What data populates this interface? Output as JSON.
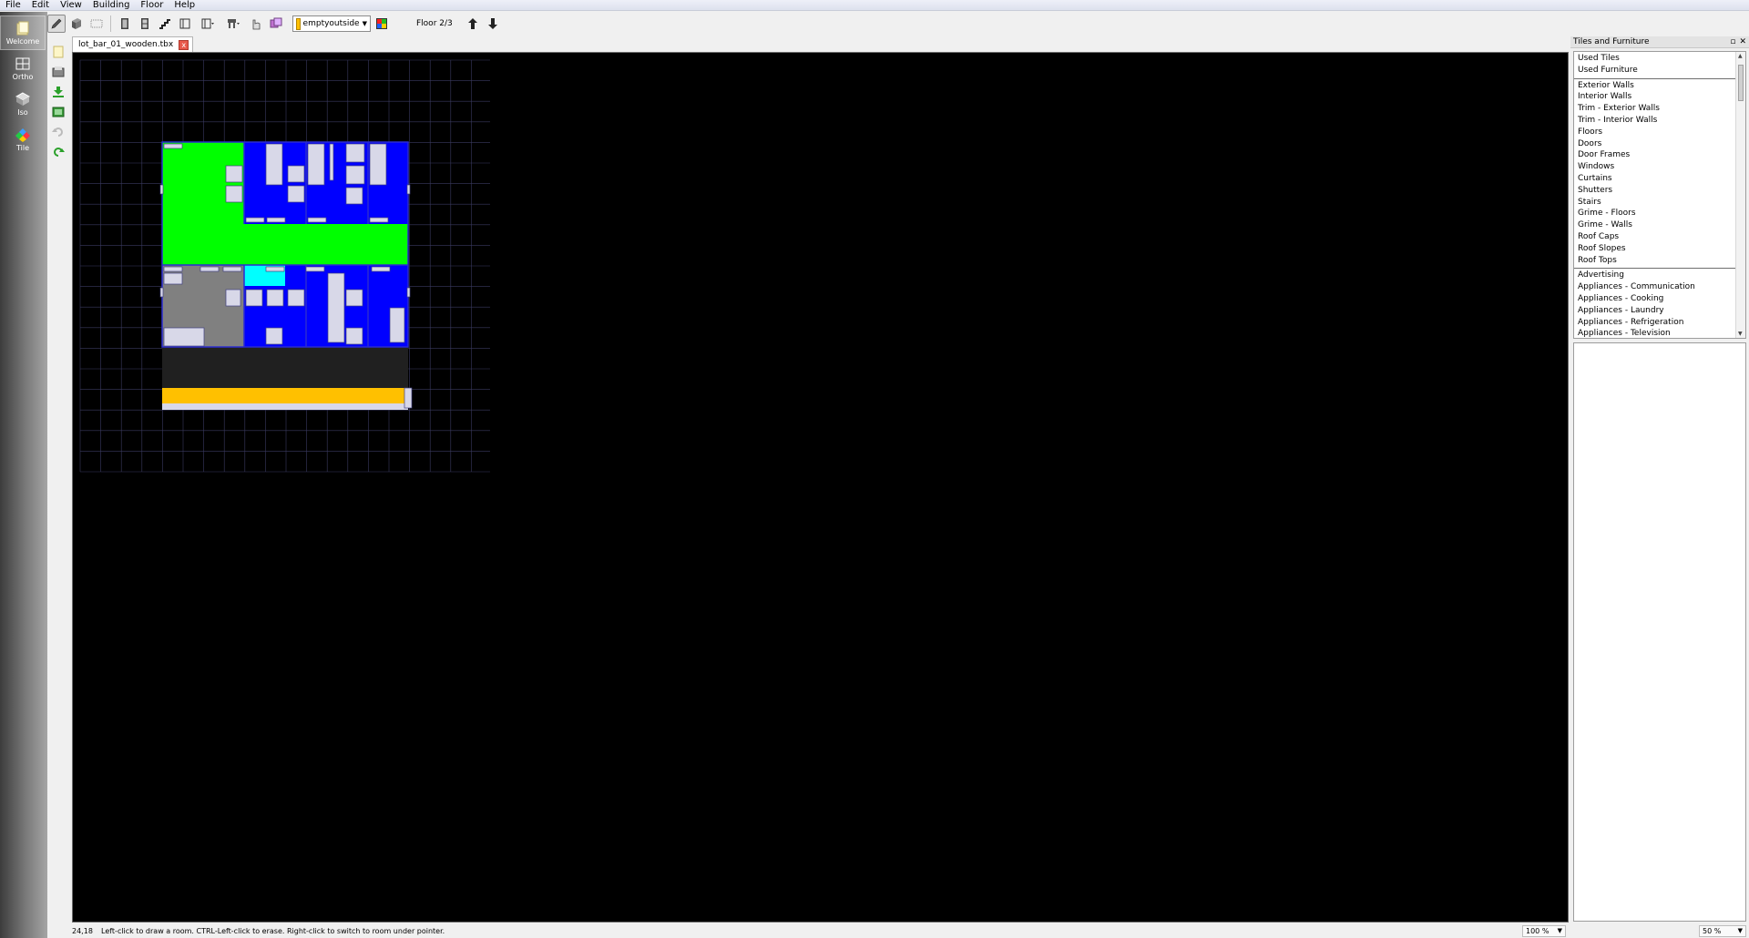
{
  "menu": {
    "items": [
      "File",
      "Edit",
      "View",
      "Building",
      "Floor",
      "Help"
    ]
  },
  "toolbar": {
    "icons": [
      "pencil-icon",
      "wall-icon",
      "grid-icon",
      "door-icon",
      "window-icon",
      "stairs-icon",
      "roof-icon",
      "roof-dropdown-icon",
      "furniture-icon",
      "select-icon",
      "eraser-icon",
      "room-icon"
    ],
    "room": {
      "name": "emptyoutside",
      "color": "#ffc000"
    },
    "floor_label": "Floor 2/3"
  },
  "modes": [
    {
      "label": "Welcome",
      "icon": "welcome-icon",
      "active": true
    },
    {
      "label": "Ortho",
      "icon": "ortho-icon",
      "active": false
    },
    {
      "label": "Iso",
      "icon": "iso-icon",
      "active": false
    },
    {
      "label": "Tile",
      "icon": "tile-icon",
      "active": false
    }
  ],
  "document": {
    "tab_title": "lot_bar_01_wooden.tbx",
    "close": "x"
  },
  "panel": {
    "title": "Tiles and Furniture",
    "float_glyph": "▫",
    "close_glyph": "✕",
    "groups": [
      [
        "Used Tiles",
        "Used Furniture"
      ],
      [
        "Exterior Walls",
        "Interior Walls",
        "Trim - Exterior Walls",
        "Trim - Interior Walls",
        "Floors",
        "Doors",
        "Door Frames",
        "Windows",
        "Curtains",
        "Shutters",
        "Stairs",
        "Grime - Floors",
        "Grime - Walls",
        "Roof Caps",
        "Roof Slopes",
        "Roof Tops"
      ],
      [
        "Advertising",
        "Appliances - Communication",
        "Appliances - Cooking",
        "Appliances - Laundry",
        "Appliances - Refrigeration",
        "Appliances - Television"
      ]
    ]
  },
  "status": {
    "coords": "24,18",
    "message": "Left-click to draw a room.  CTRL-Left-click to erase.  Right-click to switch to room under pointer.",
    "zoom_canvas": "100 %",
    "zoom_panel": "50 %"
  },
  "colors": {
    "room_green": "#00ff00",
    "room_blue": "#0000ff",
    "room_gray": "#808080",
    "room_cyan": "#00ffff",
    "room_dark": "#202020",
    "room_yellow": "#ffc000",
    "furniture": "#d8d8e8"
  }
}
